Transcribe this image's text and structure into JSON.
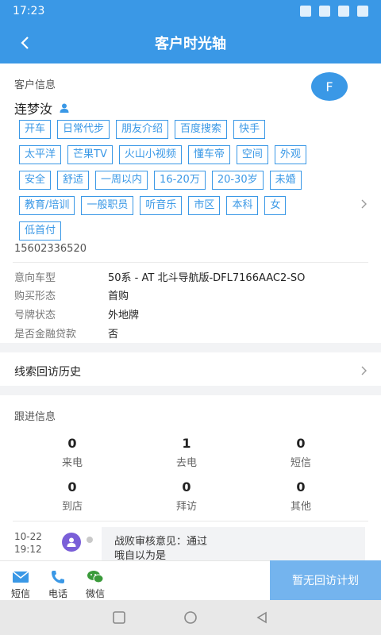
{
  "status_bar": {
    "time": "17:23"
  },
  "header": {
    "title": "客户时光轴"
  },
  "customer": {
    "section_title": "客户信息",
    "avatar_letter": "F",
    "name": "连梦汝",
    "tags": [
      [
        "开车",
        "日常代步",
        "朋友介绍",
        "百度搜索",
        "快手"
      ],
      [
        "太平洋",
        "芒果TV",
        "火山小视频",
        "懂车帝",
        "空间",
        "外观"
      ],
      [
        "安全",
        "舒适",
        "一周以内",
        "16-20万",
        "20-30岁",
        "未婚"
      ],
      [
        "教育/培训",
        "一般职员",
        "听音乐",
        "市区",
        "本科",
        "女"
      ],
      [
        "低首付"
      ]
    ],
    "phone": "15602336520",
    "details": [
      {
        "label": "意向车型",
        "value": "50系 - AT 北斗导航版-DFL7166AAC2-SO"
      },
      {
        "label": "购买形态",
        "value": "首购"
      },
      {
        "label": "号牌状态",
        "value": "外地牌"
      },
      {
        "label": "是否金融贷款",
        "value": "否"
      }
    ]
  },
  "history": {
    "label": "线索回访历史"
  },
  "followup": {
    "section_title": "跟进信息",
    "stats": [
      {
        "num": "0",
        "label": "来电"
      },
      {
        "num": "1",
        "label": "去电"
      },
      {
        "num": "0",
        "label": "短信"
      },
      {
        "num": "0",
        "label": "到店"
      },
      {
        "num": "0",
        "label": "拜访"
      },
      {
        "num": "0",
        "label": "其他"
      }
    ],
    "timeline": {
      "date": "10-22",
      "time": "19:12",
      "line1": "战败审核意见：通过",
      "line2": "哦自以为是"
    }
  },
  "bottom_bar": {
    "sms_label": "短信",
    "phone_label": "电话",
    "wechat_label": "微信",
    "plan_label": "暂无回访计划"
  },
  "colors": {
    "primary": "#3a98e6",
    "plan_button": "#74b4ee",
    "avatar_purple": "#7a5fd8"
  },
  "icons": [
    "back-arrow-icon",
    "person-icon",
    "chevron-right-icon",
    "mail-icon",
    "phone-icon",
    "wechat-icon",
    "recent-apps-icon",
    "home-icon",
    "back-nav-icon"
  ]
}
